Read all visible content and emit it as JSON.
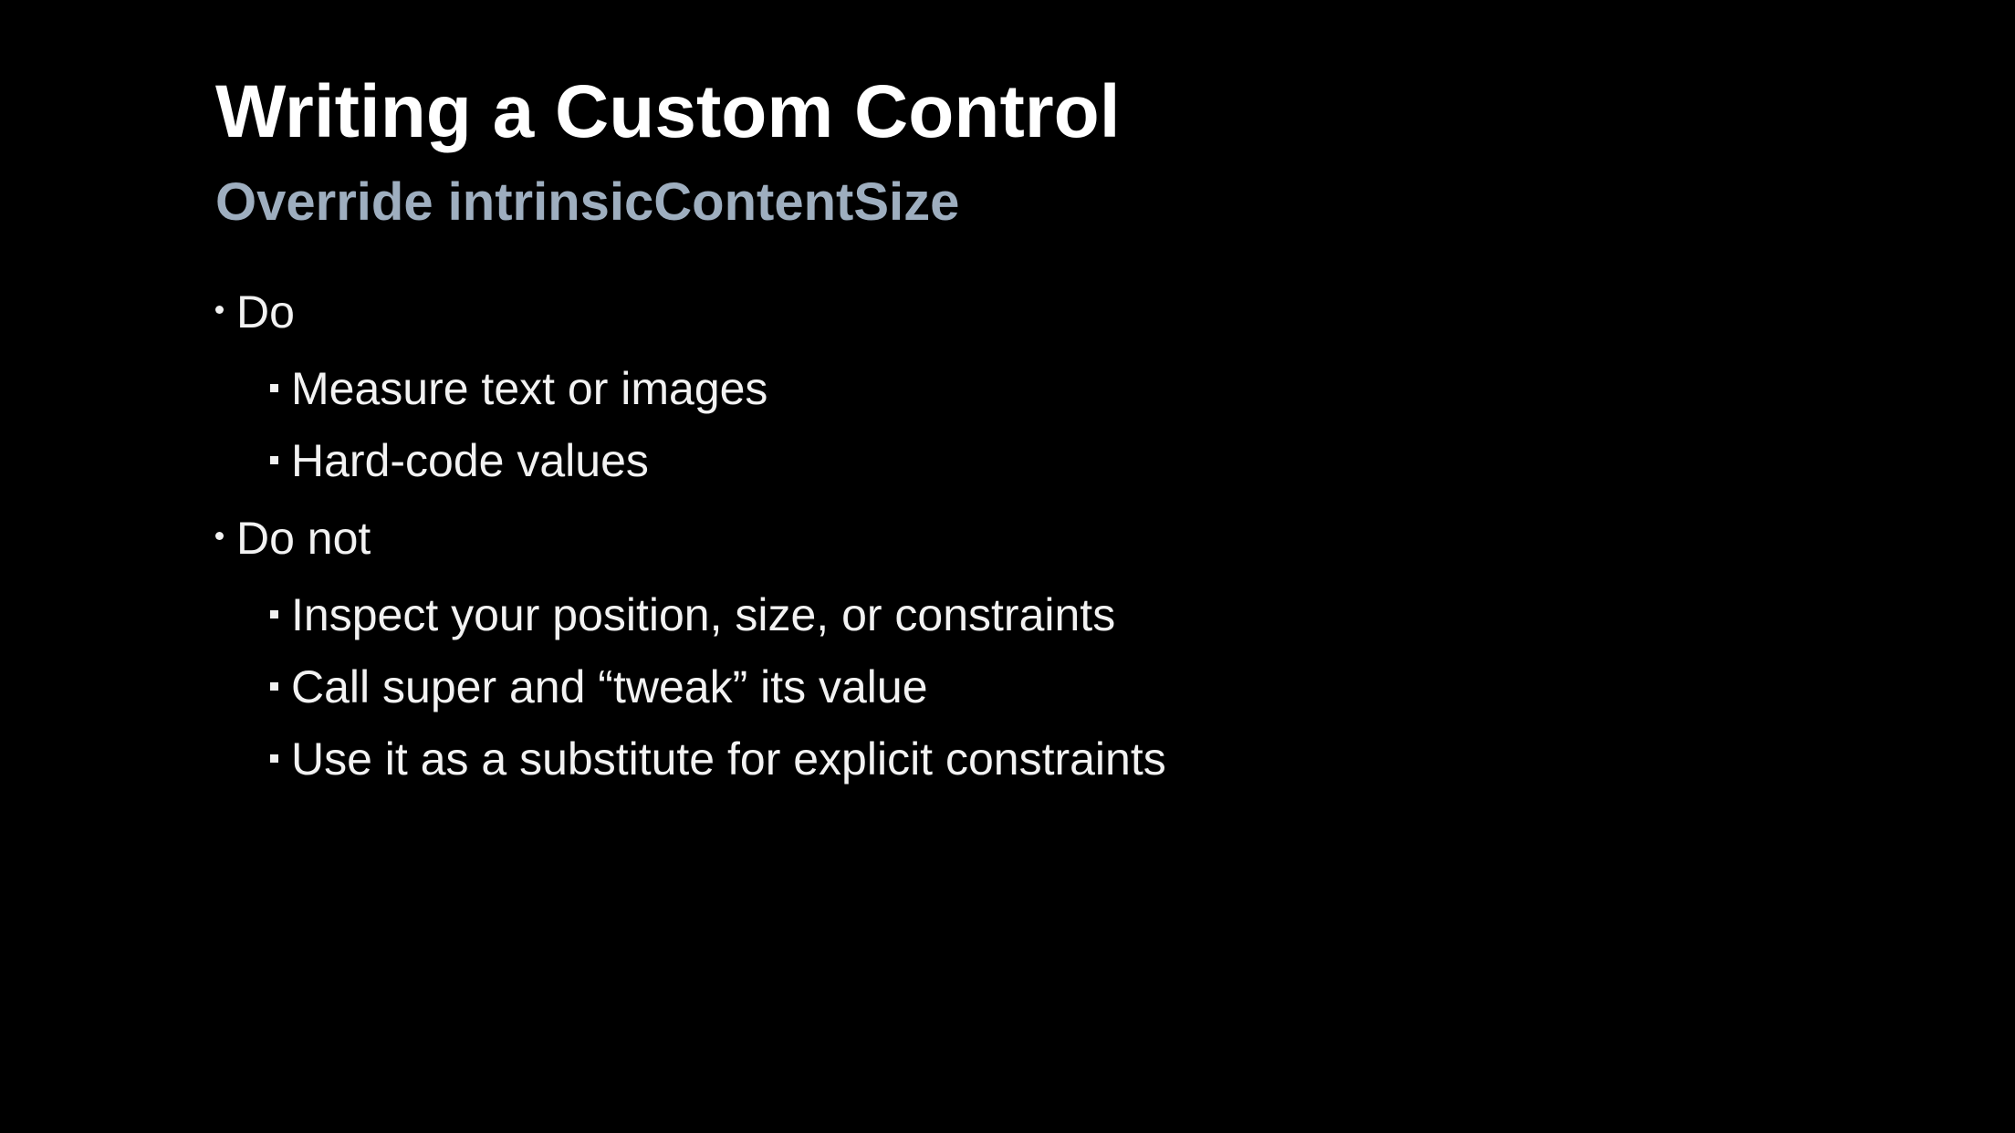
{
  "slide": {
    "title": "Writing a Custom Control",
    "subtitle": "Override intrinsicContentSize",
    "colors": {
      "background": "#000000",
      "title": "#ffffff",
      "subtitle": "#9eaebf",
      "body": "#f2f2f2"
    },
    "bullets": [
      {
        "label": "Do",
        "children": [
          "Measure text or images",
          "Hard-code values"
        ]
      },
      {
        "label": "Do not",
        "children": [
          "Inspect your position, size, or constraints",
          "Call super and “tweak” its value",
          "Use it as a substitute for explicit constraints"
        ]
      }
    ]
  }
}
